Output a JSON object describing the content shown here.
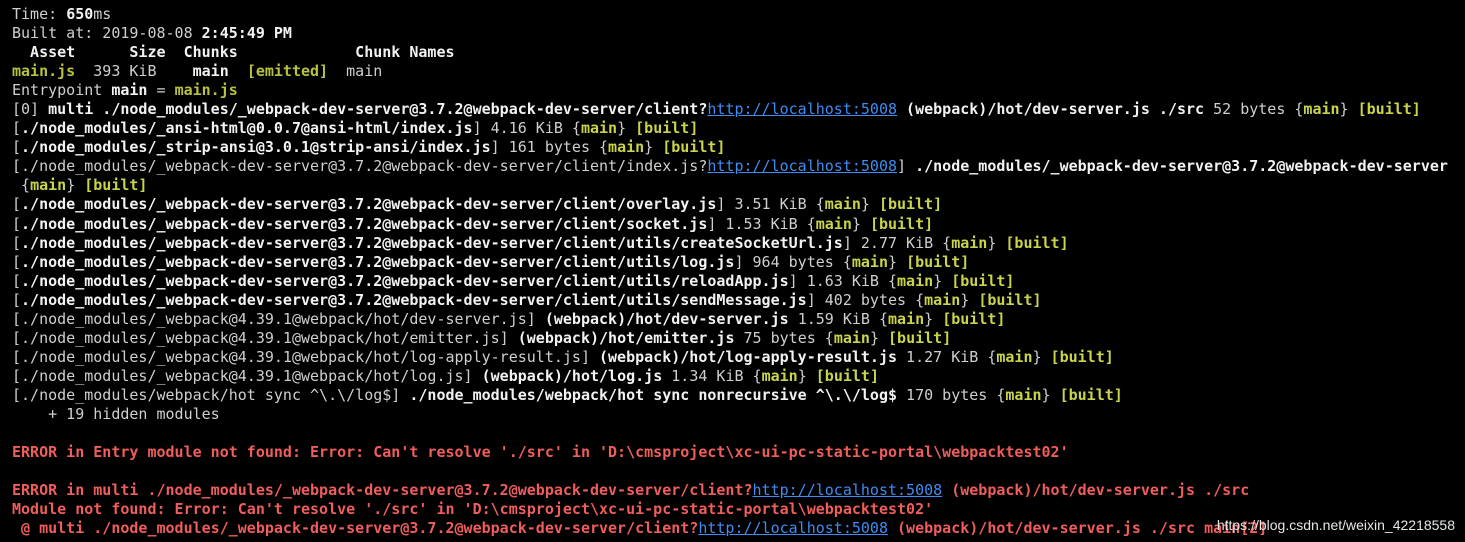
{
  "terminal": {
    "lines": [
      [
        {
          "t": "Time: ",
          "s": "d"
        },
        {
          "t": "650",
          "s": "w"
        },
        {
          "t": "ms",
          "s": "d"
        }
      ],
      [
        {
          "t": "Built at: 2019-08-08 ",
          "s": "d"
        },
        {
          "t": "2:45:49 PM",
          "s": "w"
        }
      ],
      [
        {
          "t": "  Asset      Size  Chunks             Chunk Names",
          "s": "w"
        }
      ],
      [
        {
          "t": "main.js",
          "s": "g"
        },
        {
          "t": "  393 KiB    ",
          "s": "d"
        },
        {
          "t": "main",
          "s": "w"
        },
        {
          "t": "  ",
          "s": "d"
        },
        {
          "t": "[emitted]",
          "s": "g"
        },
        {
          "t": "  main",
          "s": "d"
        }
      ],
      [
        {
          "t": "Entrypoint ",
          "s": "d"
        },
        {
          "t": "main",
          "s": "w"
        },
        {
          "t": " = ",
          "s": "d"
        },
        {
          "t": "main.js",
          "s": "g"
        }
      ],
      [
        {
          "t": "[0] ",
          "s": "d"
        },
        {
          "t": "multi ./node_modules/_webpack-dev-server@3.7.2@webpack-dev-server/client?",
          "s": "w"
        },
        {
          "t": "http://localhost:5008",
          "s": "l"
        },
        {
          "t": " (webpack)/hot/dev-server.js ./src",
          "s": "w"
        },
        {
          "t": " 52 bytes {",
          "s": "d"
        },
        {
          "t": "main",
          "s": "y"
        },
        {
          "t": "} ",
          "s": "d"
        },
        {
          "t": "[built]",
          "s": "y"
        }
      ],
      [
        {
          "t": "[",
          "s": "d"
        },
        {
          "t": "./node_modules/_ansi-html@0.0.7@ansi-html/index.js",
          "s": "w"
        },
        {
          "t": "] 4.16 KiB {",
          "s": "d"
        },
        {
          "t": "main",
          "s": "y"
        },
        {
          "t": "} ",
          "s": "d"
        },
        {
          "t": "[built]",
          "s": "y"
        }
      ],
      [
        {
          "t": "[",
          "s": "d"
        },
        {
          "t": "./node_modules/_strip-ansi@3.0.1@strip-ansi/index.js",
          "s": "w"
        },
        {
          "t": "] 161 bytes {",
          "s": "d"
        },
        {
          "t": "main",
          "s": "y"
        },
        {
          "t": "} ",
          "s": "d"
        },
        {
          "t": "[built]",
          "s": "y"
        }
      ],
      [
        {
          "t": "[./node_modules/_webpack-dev-server@3.7.2@webpack-dev-server/client/index.js?",
          "s": "d"
        },
        {
          "t": "http://localhost:5008",
          "s": "l"
        },
        {
          "t": "] ",
          "s": "d"
        },
        {
          "t": "./node_modules/_webpack-dev-server@3.7.2@webpack-dev-server",
          "s": "w"
        }
      ],
      [
        {
          "t": " {",
          "s": "d"
        },
        {
          "t": "main",
          "s": "y"
        },
        {
          "t": "} ",
          "s": "d"
        },
        {
          "t": "[built]",
          "s": "y"
        }
      ],
      [
        {
          "t": "[",
          "s": "d"
        },
        {
          "t": "./node_modules/_webpack-dev-server@3.7.2@webpack-dev-server/client/overlay.js",
          "s": "w"
        },
        {
          "t": "] 3.51 KiB {",
          "s": "d"
        },
        {
          "t": "main",
          "s": "y"
        },
        {
          "t": "} ",
          "s": "d"
        },
        {
          "t": "[built]",
          "s": "y"
        }
      ],
      [
        {
          "t": "[",
          "s": "d"
        },
        {
          "t": "./node_modules/_webpack-dev-server@3.7.2@webpack-dev-server/client/socket.js",
          "s": "w"
        },
        {
          "t": "] 1.53 KiB {",
          "s": "d"
        },
        {
          "t": "main",
          "s": "y"
        },
        {
          "t": "} ",
          "s": "d"
        },
        {
          "t": "[built]",
          "s": "y"
        }
      ],
      [
        {
          "t": "[",
          "s": "d"
        },
        {
          "t": "./node_modules/_webpack-dev-server@3.7.2@webpack-dev-server/client/utils/createSocketUrl.js",
          "s": "w"
        },
        {
          "t": "] 2.77 KiB {",
          "s": "d"
        },
        {
          "t": "main",
          "s": "y"
        },
        {
          "t": "} ",
          "s": "d"
        },
        {
          "t": "[built]",
          "s": "y"
        }
      ],
      [
        {
          "t": "[",
          "s": "d"
        },
        {
          "t": "./node_modules/_webpack-dev-server@3.7.2@webpack-dev-server/client/utils/log.js",
          "s": "w"
        },
        {
          "t": "] 964 bytes {",
          "s": "d"
        },
        {
          "t": "main",
          "s": "y"
        },
        {
          "t": "} ",
          "s": "d"
        },
        {
          "t": "[built]",
          "s": "y"
        }
      ],
      [
        {
          "t": "[",
          "s": "d"
        },
        {
          "t": "./node_modules/_webpack-dev-server@3.7.2@webpack-dev-server/client/utils/reloadApp.js",
          "s": "w"
        },
        {
          "t": "] 1.63 KiB {",
          "s": "d"
        },
        {
          "t": "main",
          "s": "y"
        },
        {
          "t": "} ",
          "s": "d"
        },
        {
          "t": "[built]",
          "s": "y"
        }
      ],
      [
        {
          "t": "[",
          "s": "d"
        },
        {
          "t": "./node_modules/_webpack-dev-server@3.7.2@webpack-dev-server/client/utils/sendMessage.js",
          "s": "w"
        },
        {
          "t": "] 402 bytes {",
          "s": "d"
        },
        {
          "t": "main",
          "s": "y"
        },
        {
          "t": "} ",
          "s": "d"
        },
        {
          "t": "[built]",
          "s": "y"
        }
      ],
      [
        {
          "t": "[./node_modules/_webpack@4.39.1@webpack/hot/dev-server.js] ",
          "s": "d"
        },
        {
          "t": "(webpack)/hot/dev-server.js",
          "s": "w"
        },
        {
          "t": " 1.59 KiB {",
          "s": "d"
        },
        {
          "t": "main",
          "s": "y"
        },
        {
          "t": "} ",
          "s": "d"
        },
        {
          "t": "[built]",
          "s": "y"
        }
      ],
      [
        {
          "t": "[./node_modules/_webpack@4.39.1@webpack/hot/emitter.js] ",
          "s": "d"
        },
        {
          "t": "(webpack)/hot/emitter.js",
          "s": "w"
        },
        {
          "t": " 75 bytes {",
          "s": "d"
        },
        {
          "t": "main",
          "s": "y"
        },
        {
          "t": "} ",
          "s": "d"
        },
        {
          "t": "[built]",
          "s": "y"
        }
      ],
      [
        {
          "t": "[./node_modules/_webpack@4.39.1@webpack/hot/log-apply-result.js] ",
          "s": "d"
        },
        {
          "t": "(webpack)/hot/log-apply-result.js",
          "s": "w"
        },
        {
          "t": " 1.27 KiB {",
          "s": "d"
        },
        {
          "t": "main",
          "s": "y"
        },
        {
          "t": "} ",
          "s": "d"
        },
        {
          "t": "[built]",
          "s": "y"
        }
      ],
      [
        {
          "t": "[./node_modules/_webpack@4.39.1@webpack/hot/log.js] ",
          "s": "d"
        },
        {
          "t": "(webpack)/hot/log.js",
          "s": "w"
        },
        {
          "t": " 1.34 KiB {",
          "s": "d"
        },
        {
          "t": "main",
          "s": "y"
        },
        {
          "t": "} ",
          "s": "d"
        },
        {
          "t": "[built]",
          "s": "y"
        }
      ],
      [
        {
          "t": "[./node_modules/webpack/hot sync ^\\.\\/log$] ",
          "s": "d"
        },
        {
          "t": "./node_modules/webpack/hot sync nonrecursive ^\\.\\/log$",
          "s": "w"
        },
        {
          "t": " 170 bytes {",
          "s": "d"
        },
        {
          "t": "main",
          "s": "y"
        },
        {
          "t": "} ",
          "s": "d"
        },
        {
          "t": "[built]",
          "s": "y"
        }
      ],
      [
        {
          "t": "    + 19 hidden modules",
          "s": "d"
        }
      ],
      [],
      [
        {
          "t": "ERROR in Entry module not found: Error: Can't resolve './src' in 'D:\\cmsproject\\xc-ui-pc-static-portal\\webpacktest02'",
          "s": "e"
        }
      ],
      [],
      [
        {
          "t": "ERROR in multi ./node_modules/_webpack-dev-server@3.7.2@webpack-dev-server/client?",
          "s": "e"
        },
        {
          "t": "http://localhost:5008",
          "s": "l"
        },
        {
          "t": " (webpack)/hot/dev-server.js ./src",
          "s": "e"
        }
      ],
      [
        {
          "t": "Module not found: Error: Can't resolve './src' in 'D:\\cmsproject\\xc-ui-pc-static-portal\\webpacktest02'",
          "s": "e"
        }
      ],
      [
        {
          "t": " @ multi ./node_modules/_webpack-dev-server@3.7.2@webpack-dev-server/client?",
          "s": "e"
        },
        {
          "t": "http://localhost:5008",
          "s": "l"
        },
        {
          "t": " (webpack)/hot/dev-server.js ./src main[2]",
          "s": "e"
        }
      ]
    ]
  },
  "watermark": "https://blog.csdn.net/weixin_42218558"
}
